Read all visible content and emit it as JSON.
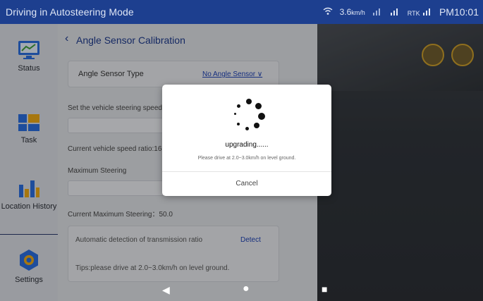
{
  "statusbar": {
    "title": "Driving in Autosteering Mode",
    "speed": "3.6",
    "speed_unit": "km/h",
    "rtk": "RTK",
    "time": "PM10:01"
  },
  "sidebar": {
    "items": [
      {
        "label": "Status",
        "icon": "status-icon"
      },
      {
        "label": "Task",
        "icon": "task-icon"
      },
      {
        "label": "Location History",
        "icon": "location-history-icon"
      },
      {
        "label": "Settings",
        "icon": "settings-icon"
      }
    ]
  },
  "calibration": {
    "title": "Angle Sensor Calibration",
    "sensor_type_label": "Angle Sensor Type",
    "sensor_type_value": "No Angle Sensor",
    "steering_speed_label": "Set the vehicle steering speed",
    "speed_ratio_label": "Current vehicle speed ratio:16",
    "max_steering_label": "Maximum Steering",
    "current_max_steering": "Current Maximum Steering：50.0",
    "auto_detect_label": "Automatic detection of transmission ratio",
    "detect_button": "Detect",
    "tips": "Tips:please drive at 2.0~3.0km/h on level ground."
  },
  "dialog": {
    "status": "upgrading......",
    "hint": "Please drive at 2.0~3.0km/h on level ground.",
    "cancel": "Cancel"
  },
  "colors": {
    "statusbar_bg": "#1d3f8f",
    "accent_blue": "#1e40af",
    "dialog_bg": "#ffffff"
  }
}
